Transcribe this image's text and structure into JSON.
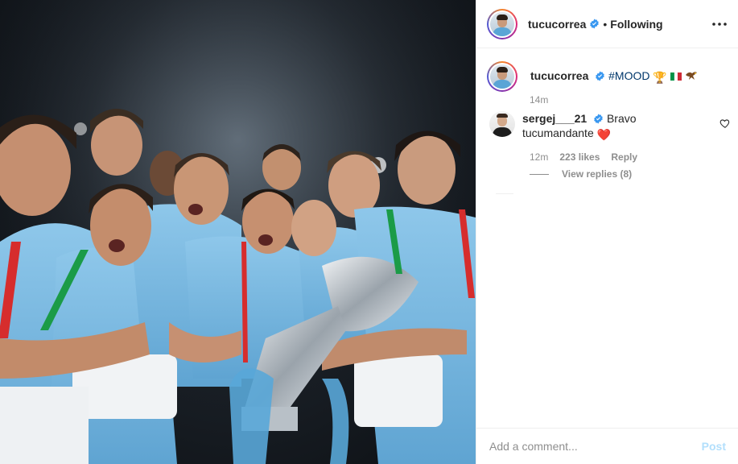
{
  "post": {
    "author": "tucucorrea",
    "follow_separator": "•",
    "follow_label": "Following",
    "more_icon": "more-horizontal-icon",
    "photo_alt": "Lazio players celebrating with Supercoppa trophy"
  },
  "caption": {
    "author": "tucucorrea",
    "hashtag": "#MOOD",
    "emojis": "🏆",
    "time": "14m"
  },
  "comments": [
    {
      "user": "sergej___21",
      "text": "Bravo tucumandante",
      "emoji": "❤️",
      "time": "12m",
      "likes": "223 likes",
      "reply_label": "Reply",
      "view_replies": "View replies (8)"
    }
  ],
  "composer": {
    "placeholder": "Add a comment...",
    "post_label": "Post"
  },
  "colors": {
    "verified": "#3897f0",
    "link": "#00376b",
    "muted": "#8e8e8e",
    "post_disabled": "#b2dffc",
    "heart": "#ed4956"
  }
}
